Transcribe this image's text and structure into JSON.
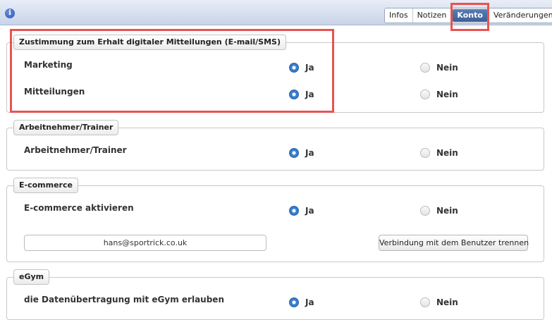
{
  "header": {
    "info_icon_glyph": "i",
    "tabs": [
      {
        "label": "Infos"
      },
      {
        "label": "Notizen"
      },
      {
        "label": "Konto"
      },
      {
        "label": "Veränderungen"
      }
    ],
    "active_tab": "Konto"
  },
  "sections": {
    "consent": {
      "legend": "Zustimmung zum Erhalt digitaler Mitteilungen (E-mail/SMS)",
      "rows": [
        {
          "label": "Marketing",
          "yes": "Ja",
          "no": "Nein",
          "selected": "Ja"
        },
        {
          "label": "Mitteilungen",
          "yes": "Ja",
          "no": "Nein",
          "selected": "Ja"
        }
      ]
    },
    "employee": {
      "legend": "Arbeitnehmer/Trainer",
      "rows": [
        {
          "label": "Arbeitnehmer/Trainer",
          "yes": "Ja",
          "no": "Nein",
          "selected": "Ja"
        }
      ]
    },
    "ecommerce": {
      "legend": "E-commerce",
      "rows": [
        {
          "label": "E-commerce aktivieren",
          "yes": "Ja",
          "no": "Nein",
          "selected": "Ja"
        }
      ],
      "email_value": "hans@sportrick.co.uk",
      "disconnect_label": "Verbindung mit dem Benutzer trennen"
    },
    "egym": {
      "legend": "eGym",
      "rows": [
        {
          "label": "die Datenübertragung mit eGym erlauben",
          "yes": "Ja",
          "no": "Nein",
          "selected": "Ja"
        }
      ]
    }
  },
  "colors": {
    "highlight": "#e9534f",
    "active_tab": "#4a6ca6",
    "radio_checked": "#3e86d6"
  }
}
